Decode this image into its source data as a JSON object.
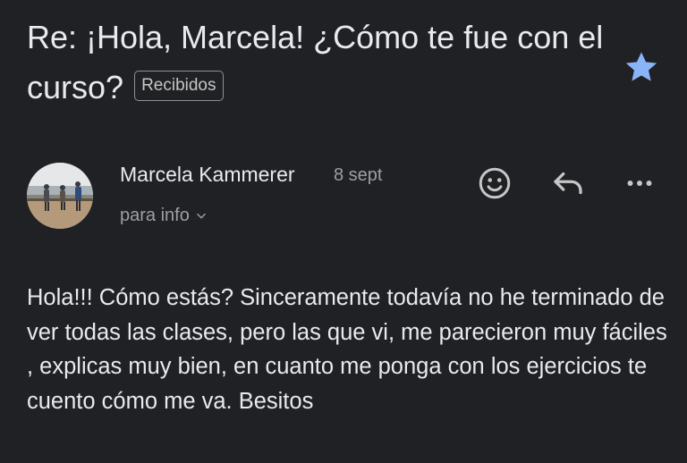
{
  "email": {
    "subject": "Re: ¡Hola, Marcela! ¿Cómo te fue con el curso?",
    "label": "Recibidos",
    "starred": true,
    "sender": {
      "name": "Marcela Kammerer",
      "date": "8 sept",
      "recipient": "para info"
    },
    "body": "Hola!!! Cómo estás? Sinceramente todavía no he terminado de ver todas las clases, pero las que vi, me parecieron muy fáciles , explicas muy bien, en cuanto me ponga con los ejercicios te cuento cómo me va. Besitos"
  },
  "icons": {
    "star": "star-icon",
    "emoji": "emoji-icon",
    "reply": "reply-icon",
    "more": "more-icon",
    "chevron": "chevron-down-icon"
  },
  "colors": {
    "background": "#202124",
    "text": "#e8eaed",
    "secondary": "#9aa0a6",
    "star": "#8ab4f8"
  }
}
